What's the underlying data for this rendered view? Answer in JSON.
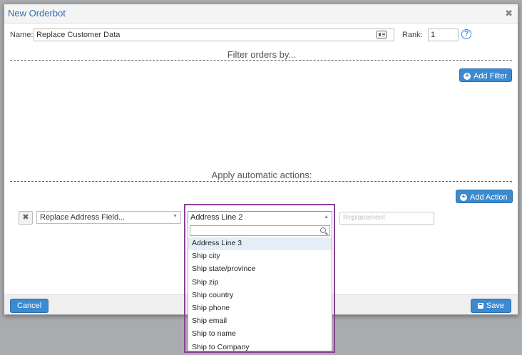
{
  "dialog": {
    "title": "New Orderbot",
    "close_glyph": "✖"
  },
  "name_field": {
    "label": "Name:",
    "value": "Replace Customer Data"
  },
  "rank_field": {
    "label": "Rank:",
    "value": "1"
  },
  "help_glyph": "?",
  "filters": {
    "section_title": "Filter orders by...",
    "add_button": "Add Filter"
  },
  "actions": {
    "section_title": "Apply automatic actions:",
    "add_button": "Add Action",
    "remove_glyph": "✖",
    "action_type": "Replace Address Field...",
    "field_value": "Address Line 2",
    "replacement_placeholder": "Replacement"
  },
  "dropdown": {
    "options": [
      "Address Line 3",
      "Ship city",
      "Ship state/province",
      "Ship zip",
      "Ship country",
      "Ship phone",
      "Ship email",
      "Ship to name",
      "Ship to Company"
    ],
    "highlighted_index": 0
  },
  "footer": {
    "cancel": "Cancel",
    "save": "Save"
  },
  "colors": {
    "accent": "#3c8ad0",
    "title": "#2a6fb5",
    "highlight_frame": "#8a3f97"
  },
  "icons": [
    "close-icon",
    "contact-card-icon",
    "help-icon",
    "plus-circle-icon",
    "remove-icon",
    "chevron-down-icon",
    "chevron-up-icon",
    "search-icon",
    "save-disk-icon"
  ]
}
